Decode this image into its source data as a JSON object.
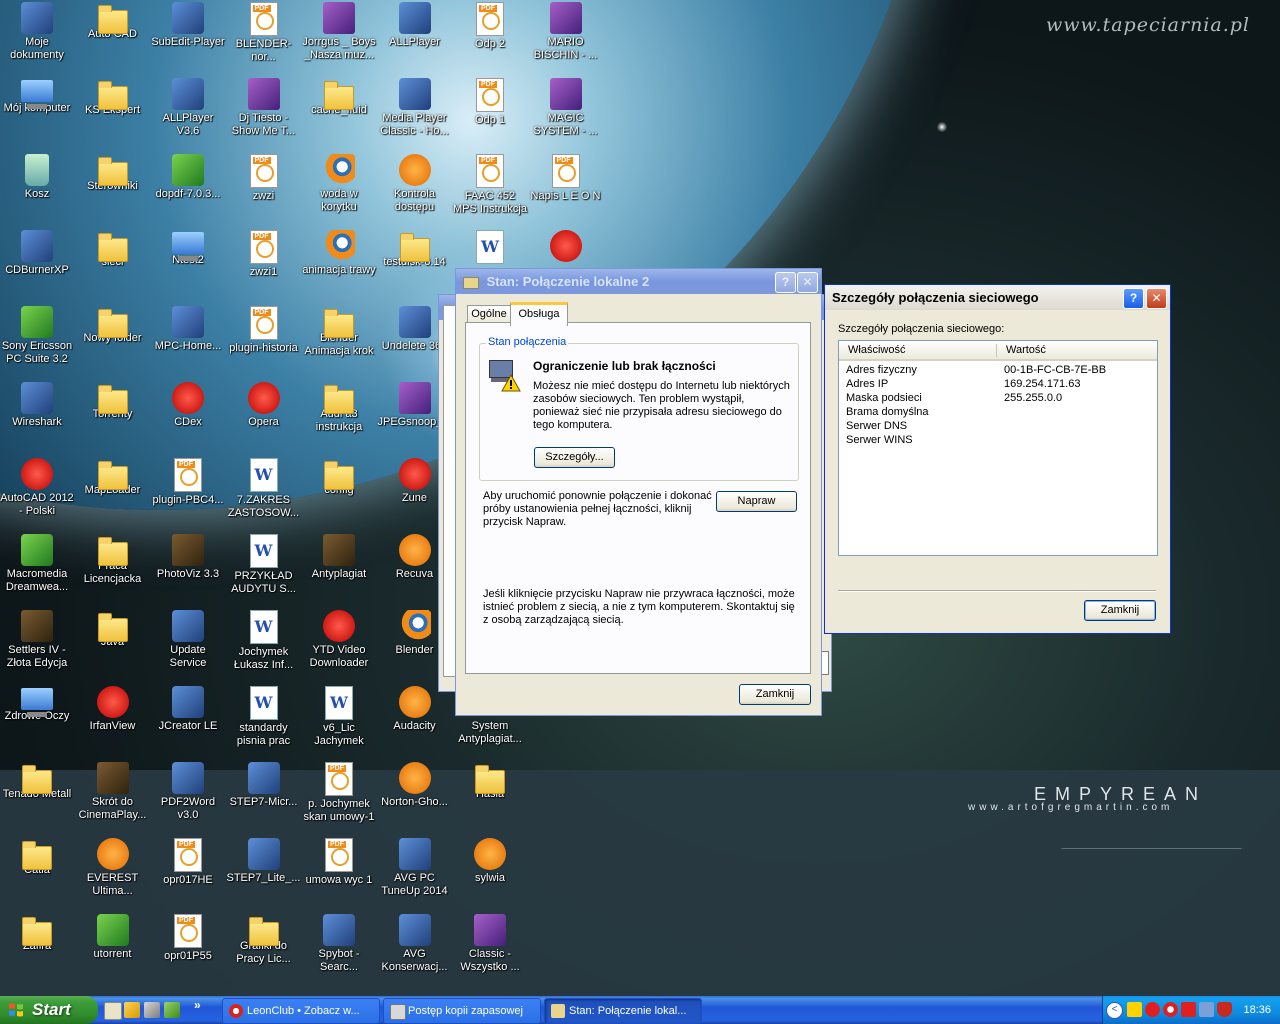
{
  "wallpaper": {
    "site": "www.tapeciarnia.pl",
    "brand": "EMPYREAN",
    "brand_url": "www.artofgregmartin.com"
  },
  "desktop": {
    "icons": [
      {
        "label": "Moje dokumenty",
        "type": "app",
        "icon": "my-documents-icon"
      },
      {
        "label": "Auto CAD",
        "type": "folder",
        "icon": "folder-icon"
      },
      {
        "label": "SubEdit-Player",
        "type": "app",
        "icon": "subedit-icon"
      },
      {
        "label": "BLENDER-nor...",
        "type": "pdf",
        "icon": "pdf-icon"
      },
      {
        "label": "Jorrgus _ Boys _Nasza muz...",
        "type": "purple",
        "icon": "media-icon"
      },
      {
        "label": "ALLPlayer",
        "type": "app",
        "icon": "allplayer-icon"
      },
      {
        "label": "Odp 2",
        "type": "pdf",
        "icon": "pdf-icon"
      },
      {
        "label": "MARIO BISCHIN - ...",
        "type": "purple",
        "icon": "media-icon"
      },
      {
        "label": "Mój komputer",
        "type": "pc",
        "icon": "my-computer-icon"
      },
      {
        "label": "KS Ekspert",
        "type": "folder",
        "icon": "folder-icon"
      },
      {
        "label": "ALLPlayer V3.6",
        "type": "app",
        "icon": "allplayer-icon"
      },
      {
        "label": "Dj Tiesto - Show Me T...",
        "type": "purple",
        "icon": "media-icon"
      },
      {
        "label": "cache_fluid",
        "type": "folder",
        "icon": "folder-icon"
      },
      {
        "label": "Media Player Classic - Ho...",
        "type": "app",
        "icon": "media-player-icon"
      },
      {
        "label": "Odp 1",
        "type": "pdf",
        "icon": "pdf-icon"
      },
      {
        "label": "MAGIC SYSTEM - ...",
        "type": "purple",
        "icon": "media-icon"
      },
      {
        "label": "Kosz",
        "type": "bin",
        "icon": "recycle-bin-icon"
      },
      {
        "label": "Sterowniki",
        "type": "folder",
        "icon": "folder-icon"
      },
      {
        "label": "dopdf-7.0.3...",
        "type": "green",
        "icon": "dopdf-icon"
      },
      {
        "label": "zwzi",
        "type": "pdf",
        "icon": "pdf-icon"
      },
      {
        "label": "woda w korytku",
        "type": "blender",
        "icon": "blender-icon"
      },
      {
        "label": "Kontrola dostępu",
        "type": "orange",
        "icon": "document-icon"
      },
      {
        "label": "FAAC 452 MPS Instrukcja",
        "type": "pdf",
        "icon": "pdf-icon"
      },
      {
        "label": "Napis L E O N",
        "type": "pdf",
        "icon": "pdf-icon"
      },
      {
        "label": "CDBurnerXP",
        "type": "app",
        "icon": "cdburner-icon"
      },
      {
        "label": "sieci",
        "type": "folder",
        "icon": "folder-icon"
      },
      {
        "label": "Ntest2",
        "type": "pc",
        "icon": "monitor-icon"
      },
      {
        "label": "zwzi1",
        "type": "pdf",
        "icon": "pdf-icon"
      },
      {
        "label": "animacja trawy",
        "type": "blender",
        "icon": "blender-icon"
      },
      {
        "label": "testdisk-6.14",
        "type": "folder",
        "icon": "folder-icon"
      },
      {
        "label": "",
        "type": "doc",
        "icon": "text-file-icon"
      },
      {
        "label": "",
        "type": "red",
        "icon": "irfan-file-icon"
      },
      {
        "label": "Sony Ericsson PC Suite 3.2",
        "type": "green",
        "icon": "sony-ericsson-icon"
      },
      {
        "label": "Nowy folder",
        "type": "folder",
        "icon": "folder-icon"
      },
      {
        "label": "MPC-Home...",
        "type": "app",
        "icon": "mpc-icon"
      },
      {
        "label": "plugin-historia",
        "type": "pdf",
        "icon": "pdf-icon"
      },
      {
        "label": "Blender Animacja krok",
        "type": "folder",
        "icon": "folder-icon"
      },
      {
        "label": "Undelete 360",
        "type": "app",
        "icon": "undelete-icon"
      },
      {
        "label": "",
        "type": "none",
        "icon": ""
      },
      {
        "label": "",
        "type": "none",
        "icon": ""
      },
      {
        "label": "Wireshark",
        "type": "app",
        "icon": "wireshark-icon"
      },
      {
        "label": "Torrenty",
        "type": "folder",
        "icon": "folder-icon"
      },
      {
        "label": "CDex",
        "type": "red",
        "icon": "cdex-icon"
      },
      {
        "label": "Opera",
        "type": "red",
        "icon": "opera-icon"
      },
      {
        "label": "Audi a3 instrukcja",
        "type": "folder",
        "icon": "folder-icon"
      },
      {
        "label": "JPEGsnoop_...",
        "type": "purple",
        "icon": "winrar-icon"
      },
      {
        "label": "",
        "type": "none",
        "icon": ""
      },
      {
        "label": "",
        "type": "none",
        "icon": ""
      },
      {
        "label": "AutoCAD 2012 - Polski",
        "type": "red",
        "icon": "autocad-icon"
      },
      {
        "label": "MapLoader",
        "type": "folder",
        "icon": "folder-icon"
      },
      {
        "label": "plugin-PBC4...",
        "type": "pdf",
        "icon": "pdf-icon"
      },
      {
        "label": "7.ZAKRES ZASTOSOW...",
        "type": "doc",
        "icon": "word-icon"
      },
      {
        "label": "config",
        "type": "folder",
        "icon": "folder-icon"
      },
      {
        "label": "Zune",
        "type": "red",
        "icon": "zune-icon"
      },
      {
        "label": "",
        "type": "none",
        "icon": ""
      },
      {
        "label": "",
        "type": "none",
        "icon": ""
      },
      {
        "label": "Macromedia Dreamwea...",
        "type": "green",
        "icon": "dreamweaver-icon"
      },
      {
        "label": "Praca Licencjacka",
        "type": "folder",
        "icon": "folder-icon"
      },
      {
        "label": "PhotoViz 3.3",
        "type": "game",
        "icon": "camera-icon"
      },
      {
        "label": "PRZYKŁAD AUDYTU S...",
        "type": "doc",
        "icon": "word-icon"
      },
      {
        "label": "Antyplagiat",
        "type": "game",
        "icon": "person-icon"
      },
      {
        "label": "Recuva",
        "type": "orange",
        "icon": "recuva-icon"
      },
      {
        "label": "",
        "type": "none",
        "icon": ""
      },
      {
        "label": "",
        "type": "none",
        "icon": ""
      },
      {
        "label": "Settlers IV - Złota Edycja",
        "type": "game",
        "icon": "settlers-icon"
      },
      {
        "label": "Java",
        "type": "folder",
        "icon": "folder-icon"
      },
      {
        "label": "Update Service",
        "type": "app",
        "icon": "update-service-icon"
      },
      {
        "label": "Jochymek Łukasz Inf...",
        "type": "doc",
        "icon": "word-icon"
      },
      {
        "label": "YTD Video Downloader",
        "type": "red",
        "icon": "ytd-icon"
      },
      {
        "label": "Blender",
        "type": "blender",
        "icon": "blender-icon"
      },
      {
        "label": "",
        "type": "none",
        "icon": ""
      },
      {
        "label": "",
        "type": "none",
        "icon": ""
      },
      {
        "label": "Zdrowe Oczy",
        "type": "pc",
        "icon": "eye-icon"
      },
      {
        "label": "IrfanView",
        "type": "red",
        "icon": "irfanview-icon"
      },
      {
        "label": "JCreator LE",
        "type": "app",
        "icon": "jcreator-icon"
      },
      {
        "label": "standardy pisnia prac",
        "type": "doc",
        "icon": "word-icon"
      },
      {
        "label": "v6_Lic Jachymek",
        "type": "doc",
        "icon": "word-icon"
      },
      {
        "label": "Audacity",
        "type": "orange",
        "icon": "audacity-icon"
      },
      {
        "label": "System Antyplagiat...",
        "type": "none",
        "icon": ""
      },
      {
        "label": "",
        "type": "none",
        "icon": ""
      },
      {
        "label": "Tenado Metall",
        "type": "folder",
        "icon": "folder-icon"
      },
      {
        "label": "Skrót do CinemaPlay...",
        "type": "game",
        "icon": "film-icon"
      },
      {
        "label": "PDF2Word v3.0",
        "type": "app",
        "icon": "pdf2word-icon"
      },
      {
        "label": "STEP7-Micr...",
        "type": "app",
        "icon": "step7-icon"
      },
      {
        "label": "p. Jochymek skan umowy-1",
        "type": "pdf",
        "icon": "pdf-icon"
      },
      {
        "label": "Norton-Gho...",
        "type": "orange",
        "icon": "norton-icon"
      },
      {
        "label": "Hasła",
        "type": "folder",
        "icon": "folder-icon"
      },
      {
        "label": "",
        "type": "none",
        "icon": ""
      },
      {
        "label": "Catia",
        "type": "folder",
        "icon": "folder-icon"
      },
      {
        "label": "EVEREST Ultima...",
        "type": "orange",
        "icon": "everest-icon"
      },
      {
        "label": "opr017HE",
        "type": "pdf",
        "icon": "pdf-icon"
      },
      {
        "label": "STEP7_Lite_...",
        "type": "app",
        "icon": "step7-icon"
      },
      {
        "label": "umowa wyc 1",
        "type": "pdf",
        "icon": "pdf-icon"
      },
      {
        "label": "AVG PC TuneUp 2014",
        "type": "app",
        "icon": "avg-icon"
      },
      {
        "label": "sylwia",
        "type": "orange",
        "icon": "key-icon"
      },
      {
        "label": "",
        "type": "none",
        "icon": ""
      },
      {
        "label": "Zafira",
        "type": "folder",
        "icon": "folder-icon"
      },
      {
        "label": "utorrent",
        "type": "green",
        "icon": "utorrent-icon"
      },
      {
        "label": "opr01P55",
        "type": "pdf",
        "icon": "pdf-icon"
      },
      {
        "label": "Grafiki do Pracy Lic...",
        "type": "folder",
        "icon": "folder-icon"
      },
      {
        "label": "Spybot - Searc...",
        "type": "app",
        "icon": "spybot-icon"
      },
      {
        "label": "AVG Konserwacj...",
        "type": "app",
        "icon": "avg-icon"
      },
      {
        "label": "Classic - Wszystko ...",
        "type": "purple",
        "icon": "media-icon"
      },
      {
        "label": "",
        "type": "none",
        "icon": ""
      }
    ]
  },
  "status_window": {
    "title": "Stan: Połączenie lokalne 2",
    "tabs": [
      "Ogólne",
      "Obsługa"
    ],
    "group_title": "Stan połączenia",
    "warning_title": "Ograniczenie lub brak łączności",
    "warning_text": "Możesz nie mieć dostępu do Internetu lub niektórych zasobów sieciowych. Ten problem wystąpił, ponieważ sieć nie przypisała adresu sieciowego do tego komputera.",
    "details_button": "Szczegóły...",
    "repair_text": "Aby uruchomić ponownie połączenie i dokonać próby ustanowienia pełnej łączności, kliknij przycisk Napraw.",
    "repair_button": "Napraw",
    "contact_text": "Jeśli kliknięcie przycisku Napraw nie przywraca łączności, może istnieć problem z siecią, a nie z tym komputerem. Skontaktuj się z osobą zarządzającą siecią.",
    "close_button": "Zamknij",
    "help_glyph": "?",
    "close_glyph": "✕"
  },
  "details_window": {
    "title": "Szczegóły połączenia sieciowego",
    "label": "Szczegóły połączenia sieciowego:",
    "col_property": "Właściwość",
    "col_value": "Wartość",
    "rows": [
      {
        "property": "Adres fizyczny",
        "value": "00-1B-FC-CB-7E-BB"
      },
      {
        "property": "Adres IP",
        "value": "169.254.171.63"
      },
      {
        "property": "Maska podsieci",
        "value": "255.255.0.0"
      },
      {
        "property": "Brama domyślna",
        "value": ""
      },
      {
        "property": "Serwer DNS",
        "value": ""
      },
      {
        "property": "Serwer WINS",
        "value": ""
      }
    ],
    "close_button": "Zamknij",
    "help_glyph": "?",
    "close_glyph": "✕"
  },
  "taskbar": {
    "start_label": "Start",
    "quick_launch_more": "»",
    "tasks": [
      {
        "label": "LeonClub • Zobacz w...",
        "icon": "opera-icon",
        "active": false
      },
      {
        "label": "Postęp kopii zapasowej",
        "icon": "backup-icon",
        "active": false
      },
      {
        "label": "Stan: Połączenie lokal...",
        "icon": "network-icon",
        "active": true
      }
    ],
    "clock": "18:36"
  },
  "colors": {
    "xp_title_blue": "#0054e3",
    "dialog_face": "#ece9d8",
    "taskbar_blue": "#2157d7",
    "start_green": "#3c9f3a"
  }
}
